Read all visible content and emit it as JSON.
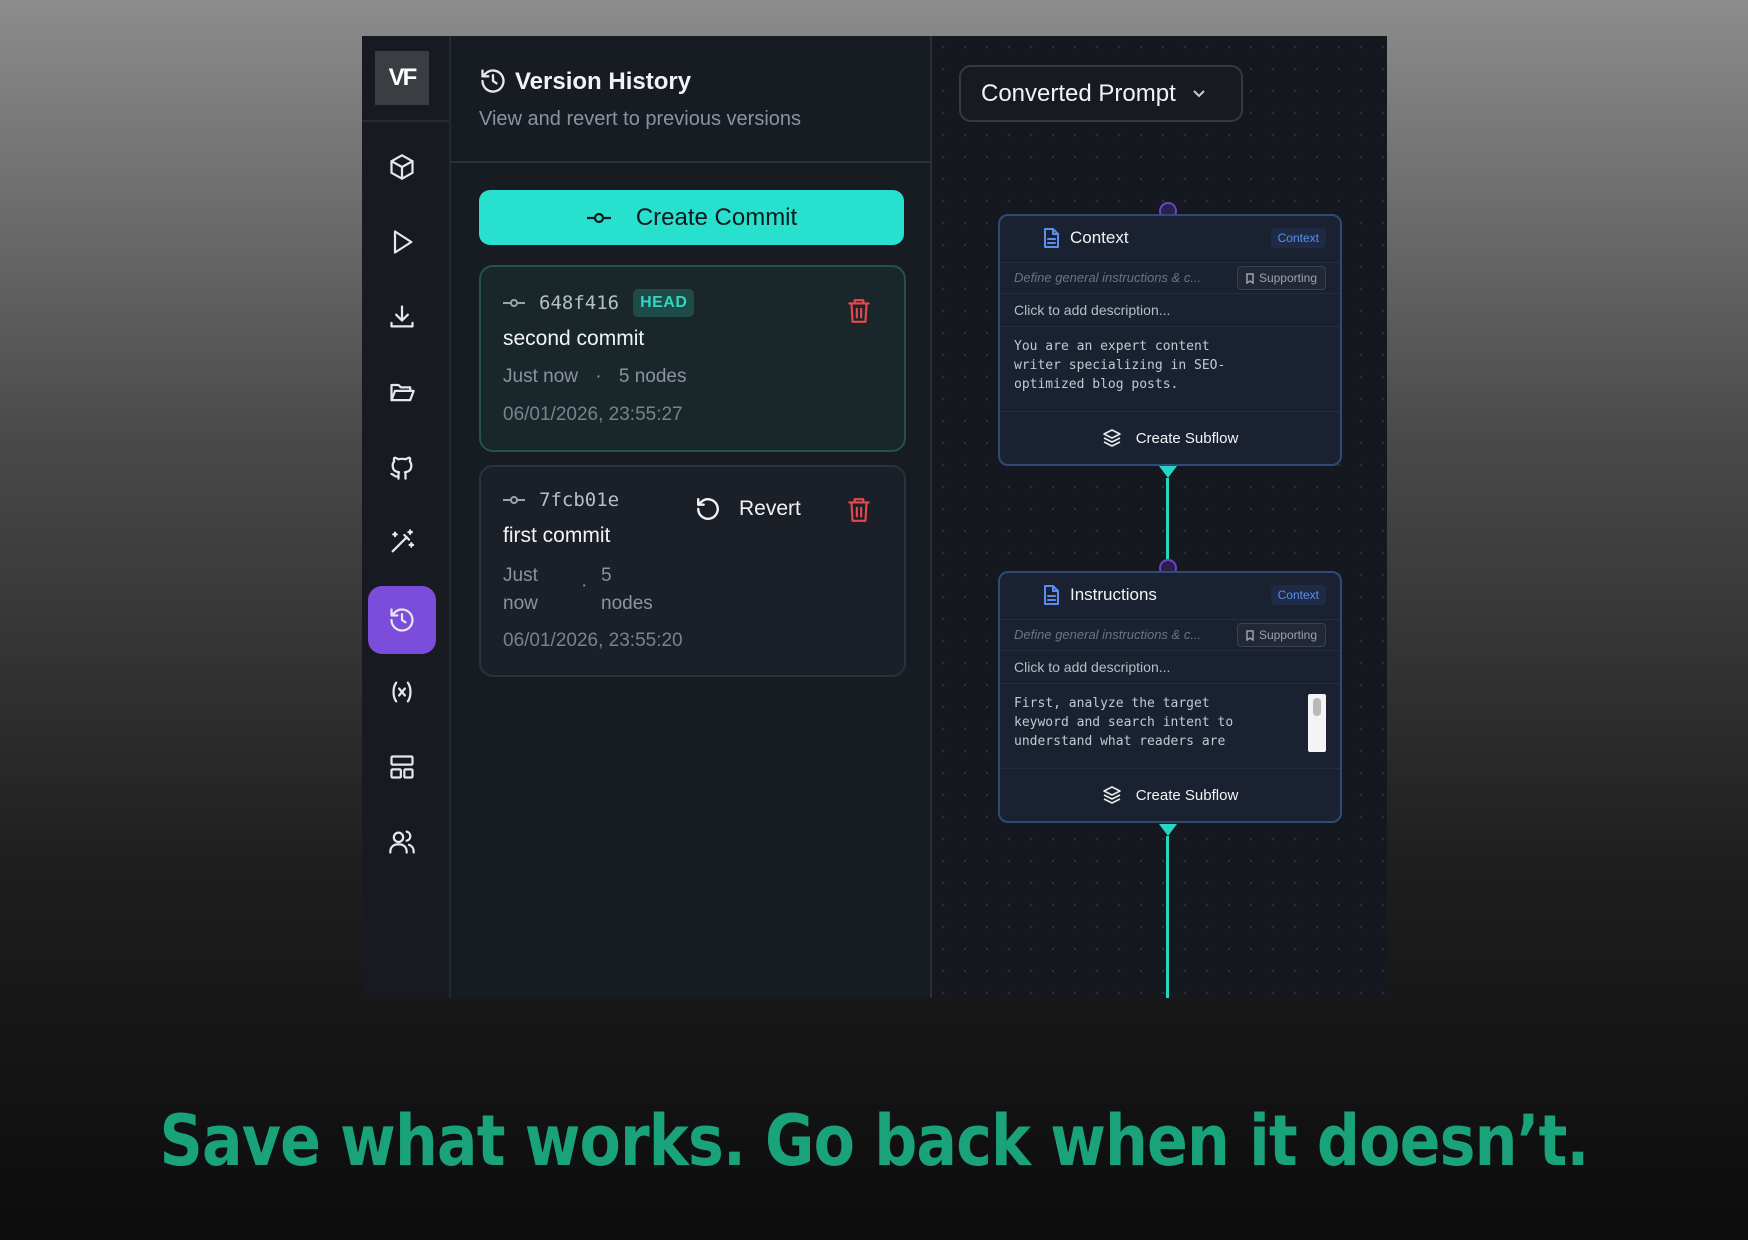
{
  "rail": {
    "logo": "VF",
    "items": [
      {
        "icon": "cube-icon"
      },
      {
        "icon": "play-icon"
      },
      {
        "icon": "download-icon"
      },
      {
        "icon": "folder-open-icon"
      },
      {
        "icon": "github-icon"
      },
      {
        "icon": "magic-wand-icon"
      },
      {
        "icon": "history-icon",
        "active": true
      },
      {
        "icon": "variable-icon"
      },
      {
        "icon": "layout-icon"
      },
      {
        "icon": "users-icon"
      }
    ]
  },
  "history": {
    "title": "Version History",
    "subtitle": "View and revert to previous versions",
    "create_label": "Create Commit",
    "commits": [
      {
        "hash": "648f416",
        "badge": "HEAD",
        "message": "second commit",
        "relative": "Just now",
        "sep": "·",
        "nodes": "5 nodes",
        "date": "06/01/2026, 23:55:27"
      },
      {
        "hash": "7fcb01e",
        "message": "first commit",
        "relative_1": "Just",
        "relative_2": "now",
        "sep": "·",
        "nodes_1": "5",
        "nodes_2": "nodes",
        "date": "06/01/2026, 23:55:20",
        "revert_label": "Revert"
      }
    ]
  },
  "canvas": {
    "dropdown_label": "Converted Prompt",
    "nodes": [
      {
        "title": "Context",
        "badge": "Context",
        "hint": "Define general instructions & c...",
        "tag": "Supporting",
        "description": "Click to add description...",
        "body": "You are an expert content\nwriter specializing in SEO-\noptimized blog posts.",
        "footer": "Create Subflow"
      },
      {
        "title": "Instructions",
        "badge": "Context",
        "hint": "Define general instructions & c...",
        "tag": "Supporting",
        "description": "Click to add description...",
        "body": "First, analyze the target\nkeyword and search intent to\nunderstand what readers are",
        "footer": "Create Subflow"
      }
    ]
  },
  "tagline": "Save what works. Go back when it doesn’t.",
  "colors": {
    "accent": "#27e0cd",
    "active_rail": "#7c4ddb",
    "danger": "#e5484d",
    "tagline": "#1aa37b"
  }
}
